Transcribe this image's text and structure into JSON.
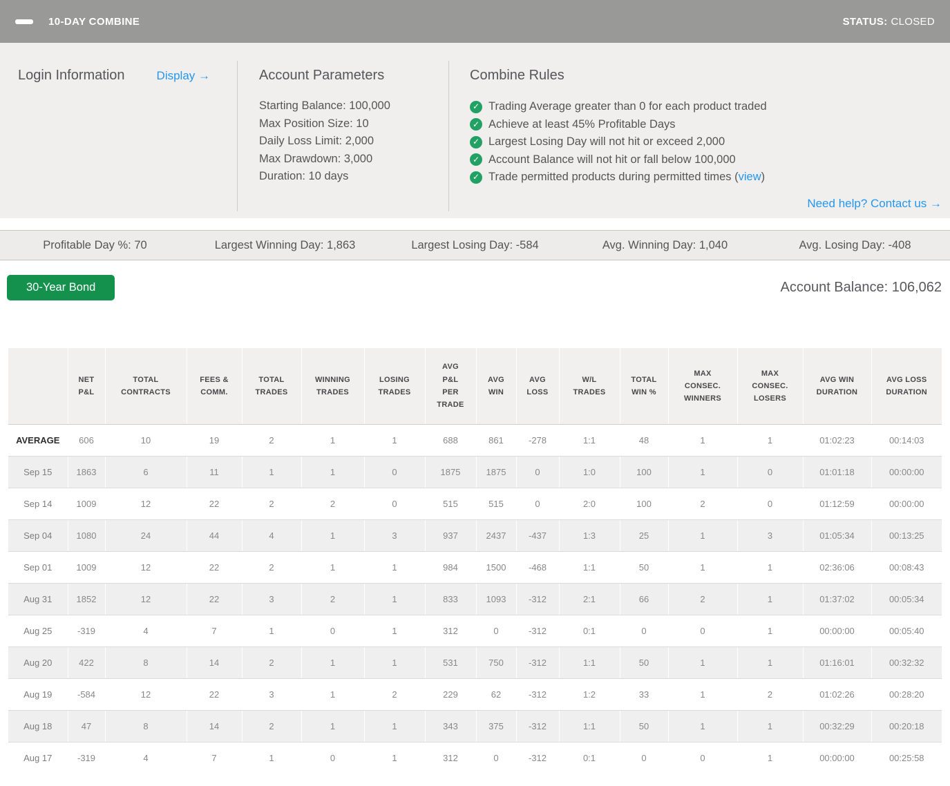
{
  "topbar": {
    "title": "10-DAY COMBINE",
    "status_label": "STATUS:",
    "status_value": "CLOSED"
  },
  "login": {
    "title": "Login Information",
    "display_link": "Display →"
  },
  "account_parameters": {
    "title": "Account Parameters",
    "lines": [
      "Starting Balance: 100,000",
      "Max Position Size: 10",
      "Daily Loss Limit: 2,000",
      "Max Drawdown: 3,000",
      "Duration: 10 days"
    ]
  },
  "combine_rules": {
    "title": "Combine Rules",
    "check_icon": "check-circle-icon",
    "items": [
      {
        "text": "Trading Average greater than 0 for each product traded"
      },
      {
        "text": "Achieve at least 45% Profitable Days"
      },
      {
        "text": "Largest Losing Day will not hit or exceed 2,000"
      },
      {
        "text": "Account Balance will not hit or fall below 100,000"
      },
      {
        "text": "Trade permitted products during permitted times (",
        "link": "view",
        "suffix": ")"
      }
    ],
    "help_link": "Need help? Contact us →"
  },
  "stats": [
    {
      "label": "Profitable Day %",
      "value": "70"
    },
    {
      "label": "Largest Winning Day",
      "value": "1,863"
    },
    {
      "label": "Largest Losing Day",
      "value": "-584"
    },
    {
      "label": "Avg. Winning Day",
      "value": "1,040"
    },
    {
      "label": "Avg. Losing Day",
      "value": "-408"
    }
  ],
  "product": {
    "button_label": "30-Year Bond",
    "balance_text": "Account Balance: 106,062"
  },
  "table": {
    "columns": [
      {
        "lines": []
      },
      {
        "lines": [
          "NET",
          "P&L"
        ]
      },
      {
        "lines": [
          "TOTAL",
          "CONTRACTS"
        ]
      },
      {
        "lines": [
          "FEES &",
          "COMM."
        ]
      },
      {
        "lines": [
          "TOTAL",
          "TRADES"
        ]
      },
      {
        "lines": [
          "WINNING",
          "TRADES"
        ]
      },
      {
        "lines": [
          "LOSING",
          "TRADES"
        ]
      },
      {
        "lines": [
          "AVG",
          "P&L",
          "PER",
          "TRADE"
        ]
      },
      {
        "lines": [
          "AVG",
          "WIN"
        ]
      },
      {
        "lines": [
          "AVG",
          "LOSS"
        ]
      },
      {
        "lines": [
          "W/L",
          "TRADES"
        ]
      },
      {
        "lines": [
          "TOTAL",
          "WIN %"
        ]
      },
      {
        "lines": [
          "MAX",
          "CONSEC.",
          "WINNERS"
        ]
      },
      {
        "lines": [
          "MAX",
          "CONSEC.",
          "LOSERS"
        ]
      },
      {
        "lines": [
          "AVG WIN",
          "DURATION"
        ]
      },
      {
        "lines": [
          "AVG LOSS",
          "DURATION"
        ]
      }
    ],
    "rows": [
      {
        "label": "AVERAGE",
        "bold": true,
        "values": [
          "606",
          "10",
          "19",
          "2",
          "1",
          "1",
          "688",
          "861",
          "-278",
          "1:1",
          "48",
          "1",
          "1",
          "01:02:23",
          "00:14:03"
        ]
      },
      {
        "label": "Sep 15",
        "values": [
          "1863",
          "6",
          "11",
          "1",
          "1",
          "0",
          "1875",
          "1875",
          "0",
          "1:0",
          "100",
          "1",
          "0",
          "01:01:18",
          "00:00:00"
        ]
      },
      {
        "label": "Sep 14",
        "values": [
          "1009",
          "12",
          "22",
          "2",
          "2",
          "0",
          "515",
          "515",
          "0",
          "2:0",
          "100",
          "2",
          "0",
          "01:12:59",
          "00:00:00"
        ]
      },
      {
        "label": "Sep 04",
        "values": [
          "1080",
          "24",
          "44",
          "4",
          "1",
          "3",
          "937",
          "2437",
          "-437",
          "1:3",
          "25",
          "1",
          "3",
          "01:05:34",
          "00:13:25"
        ]
      },
      {
        "label": "Sep 01",
        "values": [
          "1009",
          "12",
          "22",
          "2",
          "1",
          "1",
          "984",
          "1500",
          "-468",
          "1:1",
          "50",
          "1",
          "1",
          "02:36:06",
          "00:08:43"
        ]
      },
      {
        "label": "Aug 31",
        "values": [
          "1852",
          "12",
          "22",
          "3",
          "2",
          "1",
          "833",
          "1093",
          "-312",
          "2:1",
          "66",
          "2",
          "1",
          "01:37:02",
          "00:05:34"
        ]
      },
      {
        "label": "Aug 25",
        "values": [
          "-319",
          "4",
          "7",
          "1",
          "0",
          "1",
          "312",
          "0",
          "-312",
          "0:1",
          "0",
          "0",
          "1",
          "00:00:00",
          "00:05:40"
        ]
      },
      {
        "label": "Aug 20",
        "values": [
          "422",
          "8",
          "14",
          "2",
          "1",
          "1",
          "531",
          "750",
          "-312",
          "1:1",
          "50",
          "1",
          "1",
          "01:16:01",
          "00:32:32"
        ]
      },
      {
        "label": "Aug 19",
        "values": [
          "-584",
          "12",
          "22",
          "3",
          "1",
          "2",
          "229",
          "62",
          "-312",
          "1:2",
          "33",
          "1",
          "2",
          "01:02:26",
          "00:28:20"
        ]
      },
      {
        "label": "Aug 18",
        "values": [
          "47",
          "8",
          "14",
          "2",
          "1",
          "1",
          "343",
          "375",
          "-312",
          "1:1",
          "50",
          "1",
          "1",
          "00:32:29",
          "00:20:18"
        ]
      },
      {
        "label": "Aug 17",
        "values": [
          "-319",
          "4",
          "7",
          "1",
          "0",
          "1",
          "312",
          "0",
          "-312",
          "0:1",
          "0",
          "0",
          "1",
          "00:00:00",
          "00:25:58"
        ]
      }
    ]
  },
  "colors": {
    "topbar_bg": "#999998",
    "link_blue": "#2397ee",
    "check_green": "#23a164",
    "button_green": "#14914d",
    "panel_bg": "#f0efee",
    "stats_bg": "#edecea",
    "stripe_bg": "#f0efef"
  }
}
